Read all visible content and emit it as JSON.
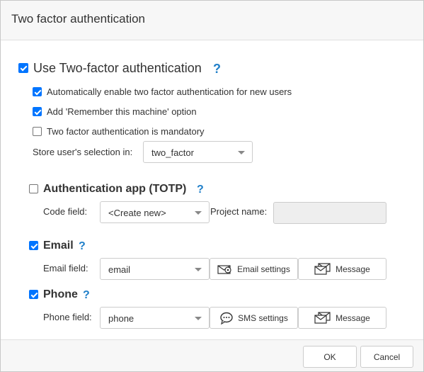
{
  "dialog": {
    "title": "Two factor authentication"
  },
  "main_option": {
    "label": "Use Two-factor authentication",
    "checked": true,
    "help": "?"
  },
  "options": [
    {
      "label": "Automatically enable two factor authentication for new users",
      "checked": true
    },
    {
      "label": "Add 'Remember this machine' option",
      "checked": true
    },
    {
      "label": "Two factor authentication is mandatory",
      "checked": false
    }
  ],
  "store_selection": {
    "label": "Store user's selection in:",
    "value": "two_factor"
  },
  "totp": {
    "label": "Authentication app (TOTP)",
    "checked": false,
    "help": "?",
    "code_field_label": "Code field:",
    "code_field_value": "<Create new>",
    "project_name_label": "Project name:",
    "project_name_value": ""
  },
  "email": {
    "label": "Email",
    "checked": true,
    "help": "?",
    "field_label": "Email field:",
    "field_value": "email",
    "settings_button": "Email settings",
    "message_button": "Message"
  },
  "phone": {
    "label": "Phone",
    "checked": true,
    "help": "?",
    "field_label": "Phone field:",
    "field_value": "phone",
    "settings_button": "SMS settings",
    "message_button": "Message"
  },
  "footer": {
    "ok_label": "OK",
    "cancel_label": "Cancel"
  },
  "icons": {
    "email_settings": "envelope-gear-icon",
    "sms_settings": "speech-bubble-icon",
    "message": "envelopes-icon"
  },
  "colors": {
    "accent": "#0075ff",
    "help": "#1f7fc9"
  }
}
